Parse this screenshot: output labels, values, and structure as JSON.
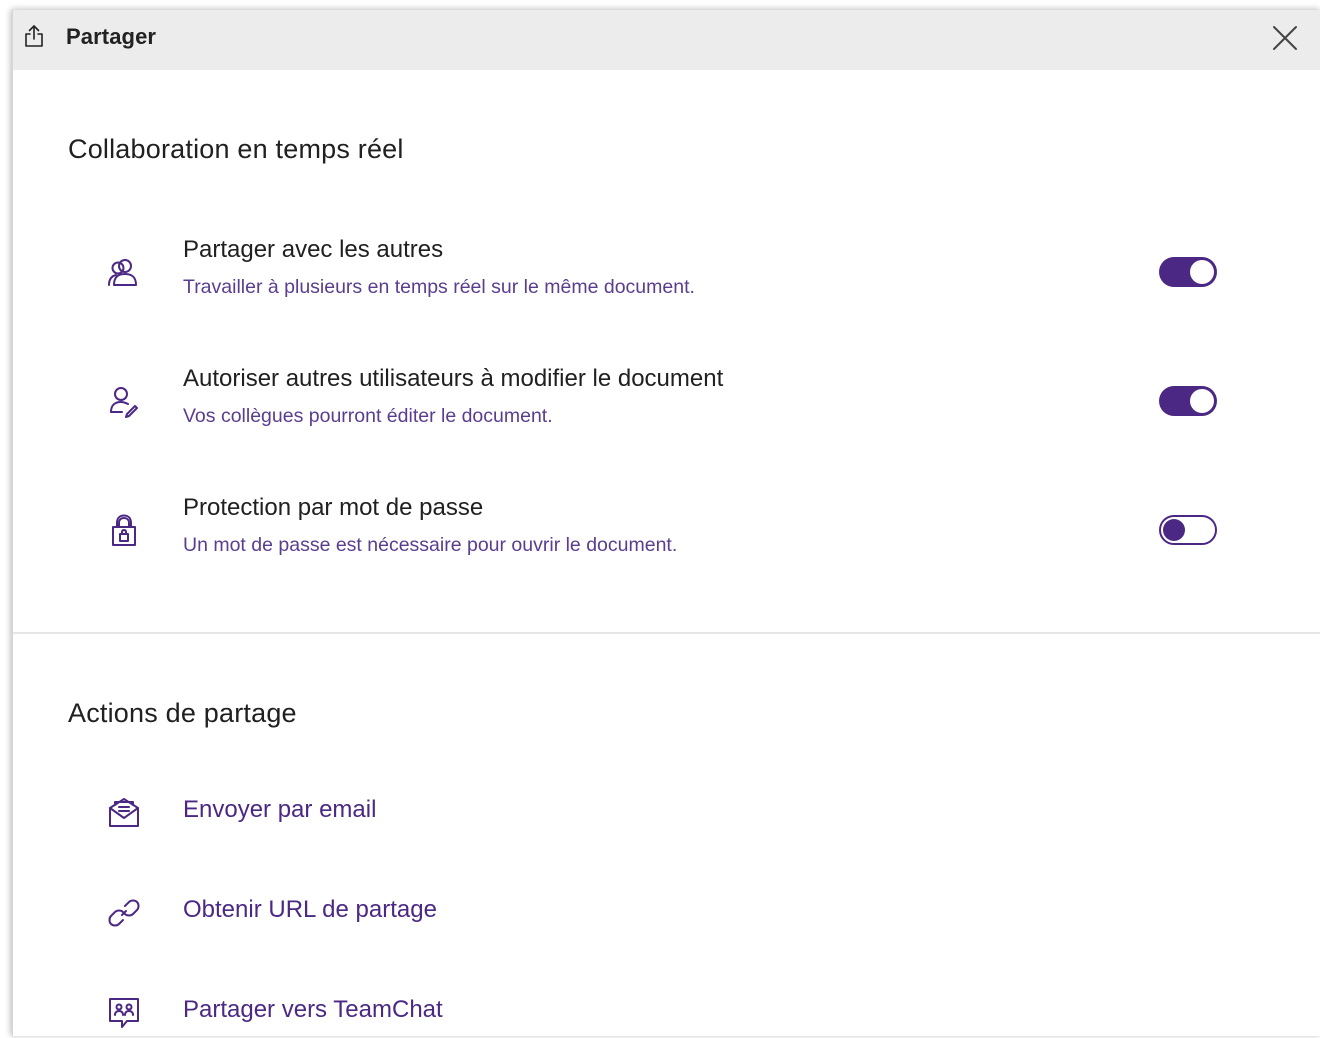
{
  "dialog": {
    "title": "Partager",
    "title_icon": "share-icon",
    "close_icon": "close-icon"
  },
  "collaboration": {
    "heading": "Collaboration en temps réel",
    "options": [
      {
        "icon": "users-icon",
        "title": "Partager avec les autres",
        "description": "Travailler à plusieurs en temps réel sur le même document.",
        "enabled": true
      },
      {
        "icon": "user-edit-icon",
        "title": "Autoriser autres utilisateurs à modifier le document",
        "description": "Vos collègues pourront éditer le document.",
        "enabled": true
      },
      {
        "icon": "lock-icon",
        "title": "Protection par mot de passe",
        "description": "Un mot de passe est nécessaire pour ouvrir le document.",
        "enabled": false
      }
    ]
  },
  "actions": {
    "heading": "Actions de partage",
    "items": [
      {
        "icon": "email-icon",
        "label": "Envoyer par email"
      },
      {
        "icon": "link-icon",
        "label": "Obtenir URL de partage"
      },
      {
        "icon": "teamchat-icon",
        "label": "Partager vers TeamChat"
      }
    ]
  },
  "colors": {
    "accent": "#4b2883",
    "titlebar_bg": "#ececec",
    "description_text": "#5b3d8f"
  }
}
